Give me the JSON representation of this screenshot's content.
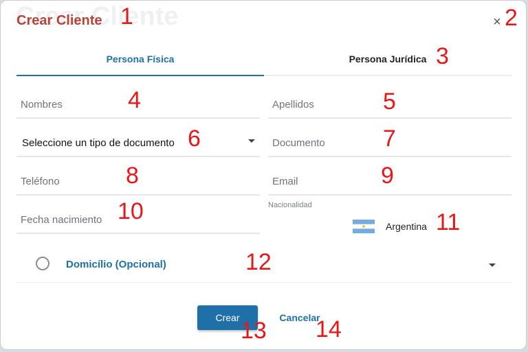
{
  "dialog": {
    "title": "Crear Cliente",
    "close_glyph": "×"
  },
  "tabs": [
    {
      "label": "Persona Física",
      "active": true
    },
    {
      "label": "Persona Jurídica",
      "active": false
    }
  ],
  "form": {
    "nombres_placeholder": "Nombres",
    "apellidos_placeholder": "Apellidos",
    "tipo_documento_value": "Seleccione un tipo de documento",
    "documento_placeholder": "Documento",
    "telefono_placeholder": "Teléfono",
    "email_placeholder": "Email",
    "fecha_placeholder": "Fecha nacimiento",
    "nacionalidad_label": "Nacionalidad",
    "nacionalidad_value": "Argentina",
    "nacionalidad_flag_icon": "argentina-flag-icon"
  },
  "domicilio": {
    "label": "Domicílio (Opcional)",
    "expand_icon": "caret-down-icon"
  },
  "actions": {
    "crear_label": "Crear",
    "cancelar_label": "Cancelar"
  },
  "annotations": [
    "1",
    "2",
    "3",
    "4",
    "5",
    "6",
    "7",
    "8",
    "9",
    "10",
    "11",
    "12",
    "13",
    "14"
  ],
  "colors": {
    "title": "#b5443b",
    "accent": "#1f6fa8",
    "annotation": "#e5191a"
  }
}
